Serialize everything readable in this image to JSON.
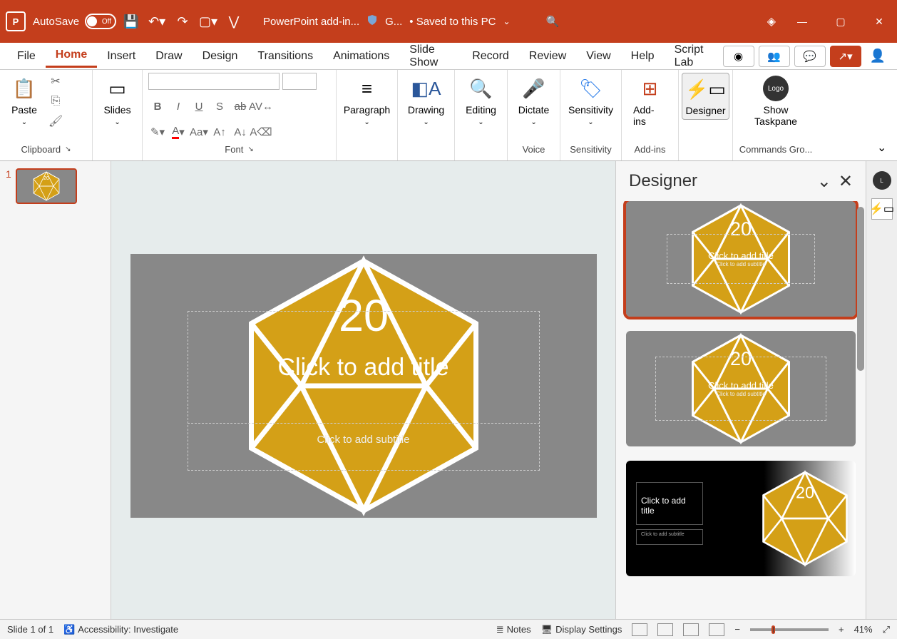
{
  "title": {
    "autosave_label": "AutoSave",
    "autosave_state": "Off",
    "addin_text": "PowerPoint add-in...",
    "sensitivity_short": "G...",
    "save_status": "• Saved to this PC"
  },
  "tabs": {
    "file": "File",
    "home": "Home",
    "insert": "Insert",
    "draw": "Draw",
    "design": "Design",
    "transitions": "Transitions",
    "animations": "Animations",
    "slideshow": "Slide Show",
    "record": "Record",
    "review": "Review",
    "view": "View",
    "help": "Help",
    "scriptlab": "Script Lab"
  },
  "ribbon": {
    "clipboard": {
      "paste": "Paste",
      "label": "Clipboard"
    },
    "slides": {
      "btn": "Slides"
    },
    "font": {
      "label": "Font"
    },
    "paragraph": {
      "btn": "Paragraph"
    },
    "drawing": {
      "btn": "Drawing"
    },
    "editing": {
      "btn": "Editing"
    },
    "voice": {
      "dictate": "Dictate",
      "label": "Voice"
    },
    "sensitivity": {
      "btn": "Sensitivity",
      "label": "Sensitivity"
    },
    "addins": {
      "btn": "Add-ins",
      "label": "Add-ins"
    },
    "designer": {
      "btn": "Designer"
    },
    "commands": {
      "btn": "Show Taskpane",
      "label": "Commands Gro...",
      "logo": "Logo"
    }
  },
  "thumbs": {
    "num1": "1"
  },
  "slide": {
    "title_ph": "Click to add title",
    "subtitle_ph": "Click to add subtitle",
    "d20_top": "20"
  },
  "designer_panel": {
    "title": "Designer",
    "card_title": "Click to add title",
    "card_sub": "Click to add subtitle"
  },
  "status": {
    "slide": "Slide 1 of 1",
    "accessibility": "Accessibility: Investigate",
    "notes": "Notes",
    "display": "Display Settings",
    "zoom": "41%"
  }
}
